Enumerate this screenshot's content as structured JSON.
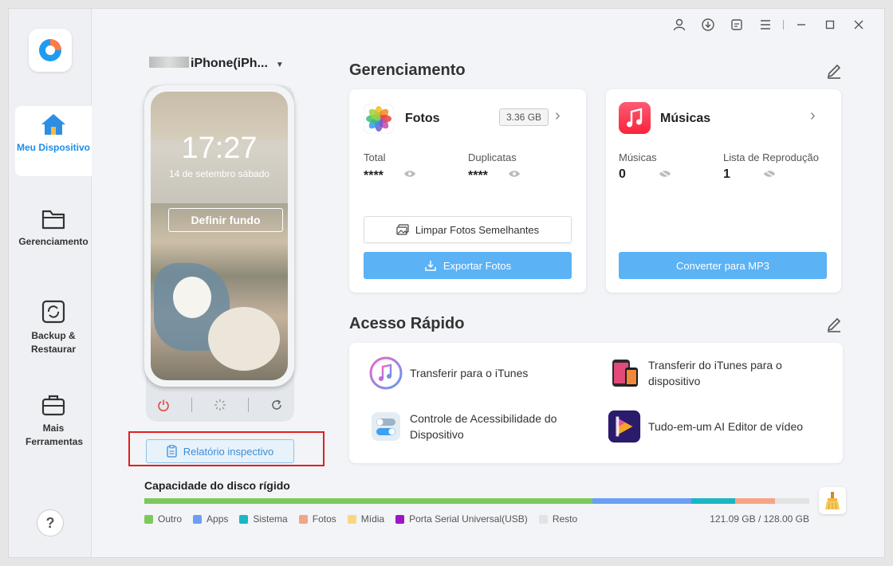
{
  "sidebar": {
    "items": [
      {
        "label": "Meu Dispositivo",
        "icon": "home-icon",
        "active": true
      },
      {
        "label": "Gerenciamento",
        "icon": "folder-icon"
      },
      {
        "label": "Backup & Restaurar",
        "icon": "backup-icon"
      },
      {
        "label": "Mais Ferramentas",
        "icon": "toolbox-icon"
      }
    ],
    "help": "?"
  },
  "device": {
    "name": "iPhone(iPh...",
    "time": "17:27",
    "date": "14 de setembro sábado",
    "set_wallpaper": "Definir fundo",
    "report_button": "Relatório inspectivo"
  },
  "management": {
    "title": "Gerenciamento",
    "photos": {
      "title": "Fotos",
      "size": "3.36 GB",
      "total_label": "Total",
      "total_value": "****",
      "dup_label": "Duplicatas",
      "dup_value": "****",
      "clean_button": "Limpar Fotos Semelhantes",
      "export_button": "Exportar Fotos"
    },
    "music": {
      "title": "Músicas",
      "songs_label": "Músicas",
      "songs_value": "0",
      "playlist_label": "Lista de Reprodução",
      "playlist_value": "1",
      "convert_button": "Converter para MP3"
    }
  },
  "quick_access": {
    "title": "Acesso Rápido",
    "items": [
      {
        "label": "Transferir para o iTunes"
      },
      {
        "label": "Transferir do iTunes para o dispositivo"
      },
      {
        "label": "Controle de Acessibilidade do Dispositivo"
      },
      {
        "label": "Tudo-em-um AI Editor de vídeo"
      }
    ]
  },
  "disk": {
    "title": "Capacidade do disco rígido",
    "used": "121.09 GB / 128.00 GB",
    "segments": [
      {
        "name": "Outro",
        "color": "#7cc95b",
        "fraction": 0.674
      },
      {
        "name": "Apps",
        "color": "#6c9ef5",
        "fraction": 0.148
      },
      {
        "name": "Sistema",
        "color": "#1ab6c4",
        "fraction": 0.066
      },
      {
        "name": "Fotos",
        "color": "#f6a486",
        "fraction": 0.061
      },
      {
        "name": "Mídia",
        "color": "#f8d77f",
        "fraction": 0.0
      },
      {
        "name": "Porta Serial Universal(USB)",
        "color": "#9b17c4",
        "fraction": 0.0
      },
      {
        "name": "Resto",
        "color": "#e3e3e3",
        "fraction": 0.051
      }
    ]
  },
  "colors": {
    "accent": "#1f8de6",
    "button_blue": "#5bb2f5",
    "highlight_red": "#e02020"
  }
}
